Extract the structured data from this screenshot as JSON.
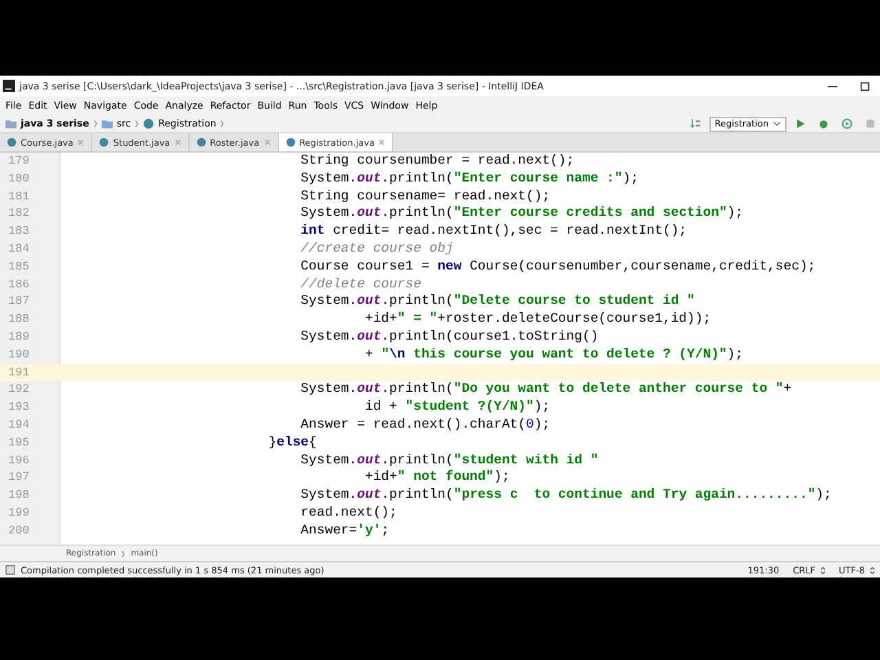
{
  "window": {
    "title": "java 3 serise [C:\\Users\\dark_\\IdeaProjects\\java 3 serise] - ...\\src\\Registration.java [java 3 serise] - IntelliJ IDEA"
  },
  "menu": [
    "File",
    "Edit",
    "View",
    "Navigate",
    "Code",
    "Analyze",
    "Refactor",
    "Build",
    "Run",
    "Tools",
    "VCS",
    "Window",
    "Help"
  ],
  "navigation": [
    "java 3 serise",
    "src",
    "Registration"
  ],
  "run_configuration": "Registration",
  "tabs": [
    {
      "label": "Course.java",
      "selected": false
    },
    {
      "label": "Student.java",
      "selected": false
    },
    {
      "label": "Roster.java",
      "selected": false
    },
    {
      "label": "Registration.java",
      "selected": true
    }
  ],
  "code": [
    {
      "number": "179",
      "current": false,
      "tokens": [
        {
          "kind": "plain",
          "text": "                             String coursenumber = read.next();"
        }
      ]
    },
    {
      "number": "180",
      "current": false,
      "tokens": [
        {
          "kind": "plain",
          "text": "                             System."
        },
        {
          "kind": "field",
          "text": "out"
        },
        {
          "kind": "plain",
          "text": ".println("
        },
        {
          "kind": "str",
          "text": "\"Enter course name :\""
        },
        {
          "kind": "plain",
          "text": ");"
        }
      ]
    },
    {
      "number": "181",
      "current": false,
      "tokens": [
        {
          "kind": "plain",
          "text": "                             String coursename= read.next();"
        }
      ]
    },
    {
      "number": "182",
      "current": false,
      "tokens": [
        {
          "kind": "plain",
          "text": "                             System."
        },
        {
          "kind": "field",
          "text": "out"
        },
        {
          "kind": "plain",
          "text": ".println("
        },
        {
          "kind": "str",
          "text": "\"Enter course credits and section\""
        },
        {
          "kind": "plain",
          "text": ");"
        }
      ]
    },
    {
      "number": "183",
      "current": false,
      "tokens": [
        {
          "kind": "kw",
          "text": "                             int"
        },
        {
          "kind": "plain",
          "text": " credit= read.nextInt(),sec = read.nextInt();"
        }
      ]
    },
    {
      "number": "184",
      "current": false,
      "tokens": [
        {
          "kind": "comment",
          "text": "                             //create course obj"
        }
      ]
    },
    {
      "number": "185",
      "current": false,
      "tokens": [
        {
          "kind": "plain",
          "text": "                             Course course1 = "
        },
        {
          "kind": "kw",
          "text": "new"
        },
        {
          "kind": "plain",
          "text": " Course(coursenumber,coursename,credit,sec);"
        }
      ]
    },
    {
      "number": "186",
      "current": false,
      "tokens": [
        {
          "kind": "comment",
          "text": "                             //delete course"
        }
      ]
    },
    {
      "number": "187",
      "current": false,
      "tokens": [
        {
          "kind": "plain",
          "text": "                             System."
        },
        {
          "kind": "field",
          "text": "out"
        },
        {
          "kind": "plain",
          "text": ".println("
        },
        {
          "kind": "str",
          "text": "\"Delete course to student id \""
        }
      ]
    },
    {
      "number": "188",
      "current": false,
      "tokens": [
        {
          "kind": "plain",
          "text": "                                     +id+"
        },
        {
          "kind": "str",
          "text": "\" = \""
        },
        {
          "kind": "plain",
          "text": "+roster.deleteCourse(course1,id));"
        }
      ]
    },
    {
      "number": "189",
      "current": false,
      "tokens": [
        {
          "kind": "plain",
          "text": "                             System."
        },
        {
          "kind": "field",
          "text": "out"
        },
        {
          "kind": "plain",
          "text": ".println(course1.toString()"
        }
      ]
    },
    {
      "number": "190",
      "current": false,
      "tokens": [
        {
          "kind": "plain",
          "text": "                                     + "
        },
        {
          "kind": "str",
          "text": "\""
        },
        {
          "kind": "esc",
          "text": "\\n"
        },
        {
          "kind": "str",
          "text": " this course you want to delete ? (Y/N)\""
        },
        {
          "kind": "plain",
          "text": ");"
        }
      ]
    },
    {
      "number": "191",
      "current": true
    },
    {
      "number": "192",
      "current": false,
      "tokens": [
        {
          "kind": "plain",
          "text": "                             System."
        },
        {
          "kind": "field",
          "text": "out"
        },
        {
          "kind": "plain",
          "text": ".println("
        },
        {
          "kind": "str",
          "text": "\"Do you want to delete anther course to \""
        },
        {
          "kind": "plain",
          "text": "+"
        }
      ]
    },
    {
      "number": "193",
      "current": false,
      "tokens": [
        {
          "kind": "plain",
          "text": "                                     id + "
        },
        {
          "kind": "str",
          "text": "\"student ?(Y/N)\""
        },
        {
          "kind": "plain",
          "text": ");"
        }
      ]
    },
    {
      "number": "194",
      "current": false,
      "tokens": [
        {
          "kind": "plain",
          "text": "                             Answer = read.next().charAt("
        },
        {
          "kind": "num",
          "text": "0"
        },
        {
          "kind": "plain",
          "text": ");"
        }
      ]
    },
    {
      "number": "195",
      "current": false,
      "tokens": [
        {
          "kind": "plain",
          "text": "                         }"
        },
        {
          "kind": "kw",
          "text": "else"
        },
        {
          "kind": "plain",
          "text": "{"
        }
      ]
    },
    {
      "number": "196",
      "current": false,
      "tokens": [
        {
          "kind": "plain",
          "text": "                             System."
        },
        {
          "kind": "field",
          "text": "out"
        },
        {
          "kind": "plain",
          "text": ".println("
        },
        {
          "kind": "str",
          "text": "\"student with id \""
        }
      ]
    },
    {
      "number": "197",
      "current": false,
      "tokens": [
        {
          "kind": "plain",
          "text": "                                     +id+"
        },
        {
          "kind": "str",
          "text": "\" not found\""
        },
        {
          "kind": "plain",
          "text": ");"
        }
      ]
    },
    {
      "number": "198",
      "current": false,
      "tokens": [
        {
          "kind": "plain",
          "text": "                             System."
        },
        {
          "kind": "field",
          "text": "out"
        },
        {
          "kind": "plain",
          "text": ".println("
        },
        {
          "kind": "str",
          "text": "\"press c  to continue and Try again.........\""
        },
        {
          "kind": "plain",
          "text": ");"
        }
      ]
    },
    {
      "number": "199",
      "current": false,
      "tokens": [
        {
          "kind": "plain",
          "text": "                             read.next();"
        }
      ]
    },
    {
      "number": "200",
      "current": false,
      "tokens": [
        {
          "kind": "plain",
          "text": "                             Answer="
        },
        {
          "kind": "str",
          "text": "'y'"
        },
        {
          "kind": "plain",
          "text": ";"
        }
      ]
    }
  ],
  "breadcrumb": [
    "Registration",
    "main()"
  ],
  "status_bar": {
    "message": "Compilation completed successfully in 1 s 854 ms (21 minutes ago)",
    "position": "191:30",
    "line_separator": "CRLF",
    "encoding": "UTF-8"
  }
}
